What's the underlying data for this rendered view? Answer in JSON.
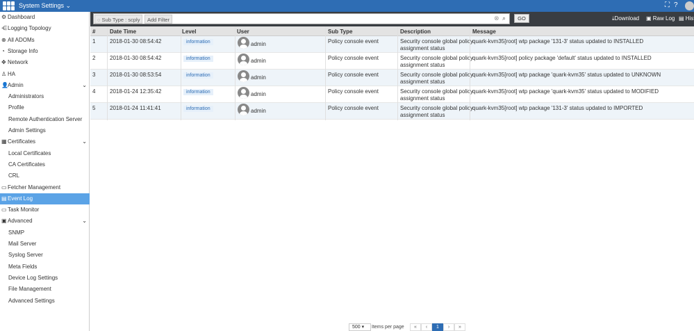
{
  "header": {
    "title": "System Settings",
    "icons": [
      "grid-logo",
      "fullscreen-icon",
      "help-icon",
      "user-avatar-icon"
    ]
  },
  "sidebar": {
    "items": [
      {
        "label": "Dashboard",
        "icon": "dashboard-icon"
      },
      {
        "label": "Logging Topology",
        "icon": "topology-icon"
      },
      {
        "label": "All ADOMs",
        "icon": "globe-icon"
      },
      {
        "label": "Storage Info",
        "icon": "storage-icon"
      },
      {
        "label": "Network",
        "icon": "network-icon"
      },
      {
        "label": "HA",
        "icon": "ha-icon"
      },
      {
        "label": "Admin",
        "icon": "user-icon",
        "expandable": true
      },
      {
        "label": "Administrators",
        "sub": true
      },
      {
        "label": "Profile",
        "sub": true
      },
      {
        "label": "Remote Authentication Server",
        "sub": true
      },
      {
        "label": "Admin Settings",
        "sub": true
      },
      {
        "label": "Certificates",
        "icon": "certificate-icon",
        "expandable": true
      },
      {
        "label": "Local Certificates",
        "sub": true
      },
      {
        "label": "CA Certificates",
        "sub": true
      },
      {
        "label": "CRL",
        "sub": true
      },
      {
        "label": "Fetcher Management",
        "icon": "fetcher-icon"
      },
      {
        "label": "Event Log",
        "icon": "event-log-icon",
        "selected": true
      },
      {
        "label": "Task Monitor",
        "icon": "task-icon"
      },
      {
        "label": "Advanced",
        "icon": "advanced-icon",
        "expandable": true
      },
      {
        "label": "SNMP",
        "sub": true
      },
      {
        "label": "Mail Server",
        "sub": true
      },
      {
        "label": "Syslog Server",
        "sub": true
      },
      {
        "label": "Meta Fields",
        "sub": true
      },
      {
        "label": "Device Log Settings",
        "sub": true
      },
      {
        "label": "File Management",
        "sub": true
      },
      {
        "label": "Advanced Settings",
        "sub": true
      }
    ]
  },
  "toolbar": {
    "filter_chip": "Sub Type : scply",
    "add_filter": "Add Filter",
    "go": "GO",
    "download": "Download",
    "raw_log": "Raw Log",
    "history": "Hist"
  },
  "table": {
    "columns": [
      "#",
      "Date Time",
      "Level",
      "User",
      "Sub Type",
      "Description",
      "Message"
    ],
    "rows": [
      [
        "1",
        "2018-01-30 08:54:42",
        "information",
        "admin",
        "Policy console event",
        "Security console global policy",
        "assignment status",
        "quark-kvm35[root] wtp package '131-3' status updated to INSTALLED"
      ],
      [
        "2",
        "2018-01-30 08:54:42",
        "information",
        "admin",
        "Policy console event",
        "Security console global policy",
        "assignment status",
        "quark-kvm35[root] policy package 'default' status updated to INSTALLED"
      ],
      [
        "3",
        "2018-01-30 08:53:54",
        "information",
        "admin",
        "Policy console event",
        "Security console global policy",
        "assignment status",
        "quark-kvm35[root] wtp package 'quark-kvm35' status updated to UNKNOWN"
      ],
      [
        "4",
        "2018-01-24 12:35:42",
        "information",
        "admin",
        "Policy console event",
        "Security console global policy",
        "assignment status",
        "quark-kvm35[root] wtp package 'quark-kvm35' status updated to MODIFIED"
      ],
      [
        "5",
        "2018-01-24 11:41:41",
        "information",
        "admin",
        "Policy console event",
        "Security console global policy",
        "assignment status",
        "quark-kvm35[root] wtp package '131-3' status updated to IMPORTED"
      ]
    ]
  },
  "pager": {
    "per_page": "500",
    "per_page_label": "Items per page",
    "first": "«",
    "prev": "‹",
    "current": "1",
    "next": "›",
    "last": "»"
  },
  "colors": {
    "accent": "#2e6db4",
    "selected": "#5ba3e6",
    "toolbar": "#393d42"
  }
}
